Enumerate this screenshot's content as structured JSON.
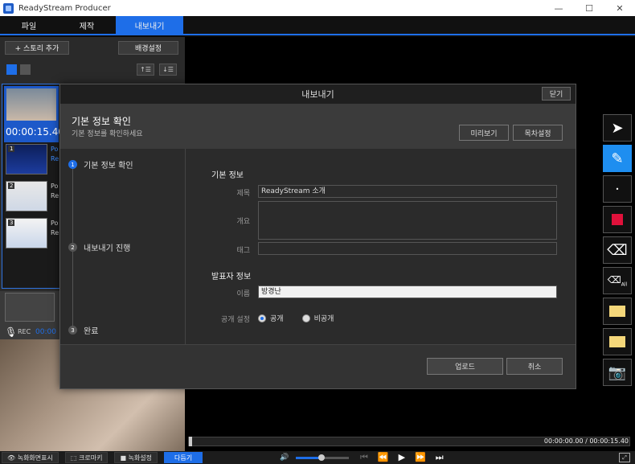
{
  "window": {
    "title": "ReadyStream Producer",
    "minimize": "—",
    "maximize": "☐",
    "close": "✕"
  },
  "menu": {
    "file": "파일",
    "produce": "제작",
    "export": "내보내기"
  },
  "left": {
    "add_story": "+ 스토리 추가",
    "bg_settings": "배경설정",
    "sort_up": "↑☰",
    "sort_down": "↓☰",
    "story_time": "00:00:15.40",
    "slides": [
      {
        "num": "1",
        "label": "Po",
        "label2": "Re"
      },
      {
        "num": "2",
        "label": "Po",
        "label2": "Re"
      },
      {
        "num": "3",
        "label": "Po",
        "label2": "Re"
      }
    ],
    "rec_label": "REC",
    "rec_time": "00:00"
  },
  "player": {
    "time": "00:00:00.00 / 00:00:15.40"
  },
  "bottom": {
    "show_recording": "녹화화면표시",
    "chroma_key": "크로마키",
    "record_settings": "녹화설정",
    "next": "다듬기"
  },
  "dialog": {
    "title": "내보내기",
    "close": "닫기",
    "header_title": "기본 정보 확인",
    "header_sub": "기본 정보를 확인하세요",
    "preview": "미리보기",
    "toc_settings": "목차설정",
    "steps": [
      {
        "num": "1",
        "label": "기본 정보 확인"
      },
      {
        "num": "2",
        "label": "내보내기 진행"
      },
      {
        "num": "3",
        "label": "완료"
      }
    ],
    "basic_info": "기본 정보",
    "title_label": "제목",
    "title_value": "ReadyStream 소개",
    "summary_label": "개요",
    "summary_value": "",
    "tag_label": "태그",
    "tag_value": "",
    "presenter_info": "발표자 정보",
    "name_label": "이름",
    "name_value": "방경난",
    "visibility_label": "공개 설정",
    "public": "공개",
    "private": "비공개",
    "upload": "업로드",
    "cancel": "취소"
  },
  "colors": {
    "accent": "#1e6ee8",
    "active_tool": "#1e8ef0",
    "pen_color": "#e0113b"
  }
}
